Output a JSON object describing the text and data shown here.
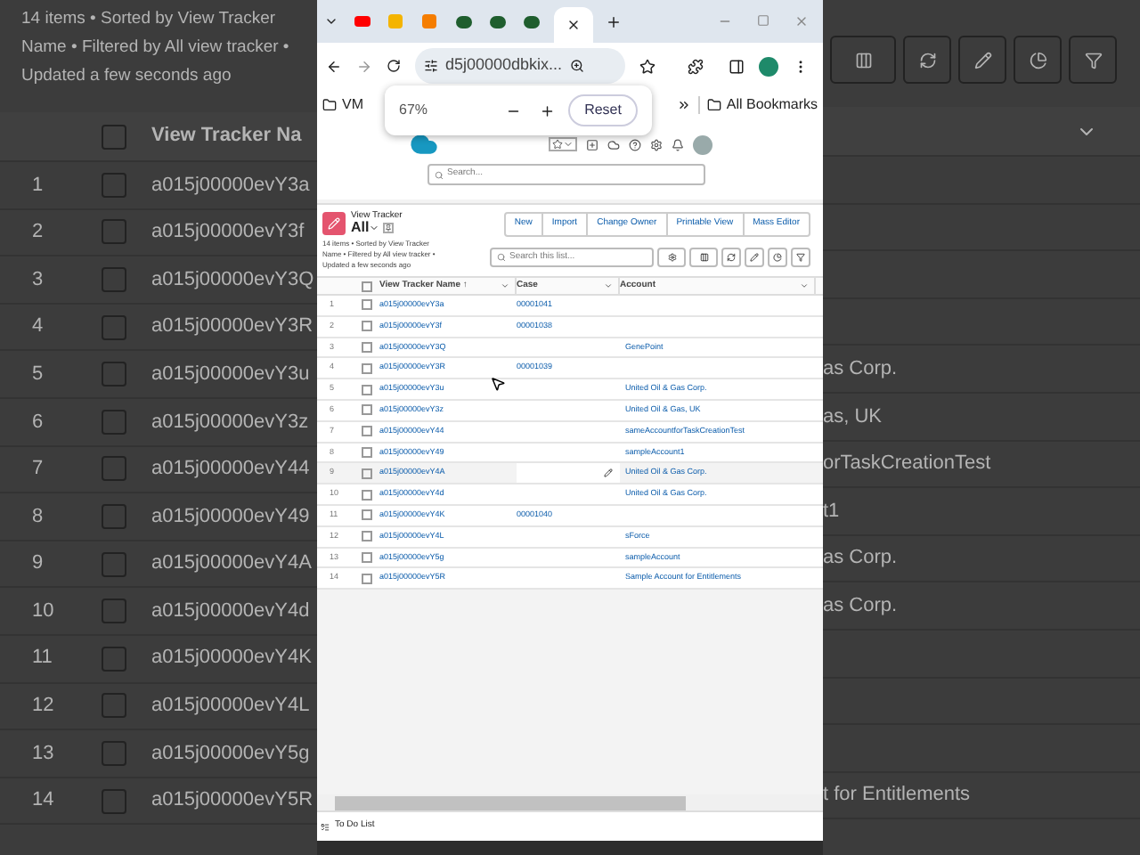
{
  "background": {
    "summary": [
      "14 items • Sorted by View Tracker",
      "Name • Filtered by All view tracker •",
      "Updated a few seconds ago"
    ],
    "column": "View Tracker Na",
    "all_checked": false,
    "rows": [
      {
        "number": "1",
        "name": "a015j00000evY3a",
        "checked": false
      },
      {
        "number": "2",
        "name": "a015j00000evY3f",
        "checked": false
      },
      {
        "number": "3",
        "name": "a015j00000evY3Q",
        "checked": false
      },
      {
        "number": "4",
        "name": "a015j00000evY3R",
        "checked": false
      },
      {
        "number": "5",
        "name": "a015j00000evY3u",
        "checked": false,
        "account": "as Corp."
      },
      {
        "number": "6",
        "name": "a015j00000evY3z",
        "checked": false,
        "account": "as, UK"
      },
      {
        "number": "7",
        "name": "a015j00000evY44",
        "checked": false,
        "account": "orTaskCreationTest"
      },
      {
        "number": "8",
        "name": "a015j00000evY49",
        "checked": false,
        "account": "t1"
      },
      {
        "number": "9",
        "name": "a015j00000evY4A",
        "checked": false,
        "account": "as Corp."
      },
      {
        "number": "10",
        "name": "a015j00000evY4d",
        "checked": false,
        "account": "as Corp."
      },
      {
        "number": "11",
        "name": "a015j00000evY4K",
        "checked": false
      },
      {
        "number": "12",
        "name": "a015j00000evY4L",
        "checked": false
      },
      {
        "number": "13",
        "name": "a015j00000evY5g",
        "checked": false
      },
      {
        "number": "14",
        "name": "a015j00000evY5R",
        "checked": false,
        "account": "t for Entitlements"
      }
    ]
  },
  "browser": {
    "tabs": [
      {
        "selected": false
      },
      {
        "selected": false
      },
      {
        "selected": false
      },
      {
        "selected": false
      },
      {
        "selected": false
      },
      {
        "selected": false
      },
      {
        "selected": true
      }
    ],
    "address": "d5j00000dbkix...",
    "bookmarks": [
      "VM"
    ],
    "all_bookmarks": "All Bookmarks",
    "zoom_popup": {
      "value": "67%",
      "reset": "Reset"
    }
  },
  "header": {
    "search": {
      "placeholder": "Search..."
    }
  },
  "list": {
    "object": "View Tracker",
    "view": "All",
    "summary": [
      "14 items • Sorted by View Tracker",
      "Name • Filtered by All view tracker •",
      "Updated a few seconds ago"
    ],
    "buttons": [
      "New",
      "Import",
      "Change Owner",
      "Printable View",
      "Mass Editor"
    ],
    "search": {
      "placeholder": "Search this list..."
    },
    "columns": [
      "View Tracker Name ↑",
      "Case",
      "Account"
    ],
    "all_checked": false,
    "rows": [
      {
        "number": "1",
        "name": "a015j00000evY3a",
        "case": "00001041",
        "account": "",
        "checked": false,
        "highlighted": false
      },
      {
        "number": "2",
        "name": "a015j00000evY3f",
        "case": "00001038",
        "account": "",
        "checked": false,
        "highlighted": false
      },
      {
        "number": "3",
        "name": "a015j00000evY3Q",
        "case": "",
        "account": "GenePoint",
        "checked": false,
        "highlighted": false
      },
      {
        "number": "4",
        "name": "a015j00000evY3R",
        "case": "00001039",
        "account": "",
        "checked": false,
        "highlighted": false
      },
      {
        "number": "5",
        "name": "a015j00000evY3u",
        "case": "",
        "account": "United Oil & Gas Corp.",
        "checked": false,
        "highlighted": false
      },
      {
        "number": "6",
        "name": "a015j00000evY3z",
        "case": "",
        "account": "United Oil & Gas, UK",
        "checked": false,
        "highlighted": false
      },
      {
        "number": "7",
        "name": "a015j00000evY44",
        "case": "",
        "account": "sameAccountforTaskCreationTest",
        "checked": false,
        "highlighted": false
      },
      {
        "number": "8",
        "name": "a015j00000evY49",
        "case": "",
        "account": "sampleAccount1",
        "checked": false,
        "highlighted": false
      },
      {
        "number": "9",
        "name": "a015j00000evY4A",
        "case": "",
        "account": "United Oil & Gas Corp.",
        "checked": false,
        "highlighted": true
      },
      {
        "number": "10",
        "name": "a015j00000evY4d",
        "case": "",
        "account": "United Oil & Gas Corp.",
        "checked": false,
        "highlighted": false
      },
      {
        "number": "11",
        "name": "a015j00000evY4K",
        "case": "00001040",
        "account": "",
        "checked": false,
        "highlighted": false
      },
      {
        "number": "12",
        "name": "a015j00000evY4L",
        "case": "",
        "account": "sForce",
        "checked": false,
        "highlighted": false
      },
      {
        "number": "13",
        "name": "a015j00000evY5g",
        "case": "",
        "account": "sampleAccount",
        "checked": false,
        "highlighted": false
      },
      {
        "number": "14",
        "name": "a015j00000evY5R",
        "case": "",
        "account": "Sample Account for Entitlements",
        "checked": false,
        "highlighted": false
      }
    ]
  },
  "footer": {
    "label": "To Do List"
  }
}
